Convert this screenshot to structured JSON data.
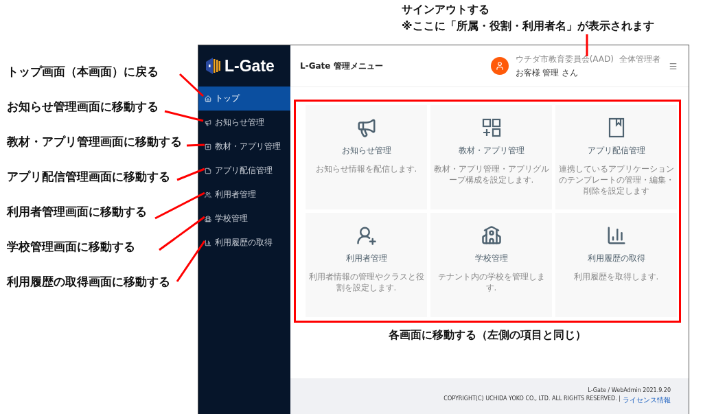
{
  "top_annotation": [
    "サインアウトする",
    "※ここに「所属・役割・利用者名」が表示されます"
  ],
  "side_annotations": [
    "トップ画面（本画面）に戻る",
    "お知らせ管理画面に移動する",
    "教材・アプリ管理画面に移動する",
    "アプリ配信管理画面に移動する",
    "利用者管理画面に移動する",
    "学校管理画面に移動する",
    "利用履歴の取得画面に移動する"
  ],
  "logo": "L-Gate",
  "sidebar": {
    "items": [
      {
        "label": "トップ",
        "selected": true
      },
      {
        "label": "お知らせ管理",
        "selected": false
      },
      {
        "label": "教材・アプリ管理",
        "selected": false
      },
      {
        "label": "アプリ配信管理",
        "selected": false
      },
      {
        "label": "利用者管理",
        "selected": false
      },
      {
        "label": "学校管理",
        "selected": false
      },
      {
        "label": "利用履歴の取得",
        "selected": false
      }
    ]
  },
  "header": {
    "title": "L-Gate 管理メニュー",
    "organization": "ウチダ市教育委員会(AAD)",
    "role": "全体管理者",
    "user_name": "お客様 管理 さん"
  },
  "cards": [
    {
      "title": "お知らせ管理",
      "description": "お知らせ情報を配信します."
    },
    {
      "title": "教材・アプリ管理",
      "description": "教材・アプリ管理・アプリグループ構成を設定します."
    },
    {
      "title": "アプリ配信管理",
      "description": "連携しているアプリケーションのテンプレートの管理・編集・削除を設定します"
    },
    {
      "title": "利用者管理",
      "description": "利用者情報の管理やクラスと役割を設定します."
    },
    {
      "title": "学校管理",
      "description": "テナント内の学校を管理します."
    },
    {
      "title": "利用履歴の取得",
      "description": "利用履歴を取得します."
    }
  ],
  "cards_annotation": "各画面に移動する（左側の項目と同じ）",
  "footer": {
    "version": "L-Gate / WebAdmin 2021.9.20",
    "copyright": "COPYRIGHT(C) UCHIDA YOKO CO., LTD. ALL RIGHTS RESERVED. |",
    "license_link": "ライセンス情報"
  }
}
